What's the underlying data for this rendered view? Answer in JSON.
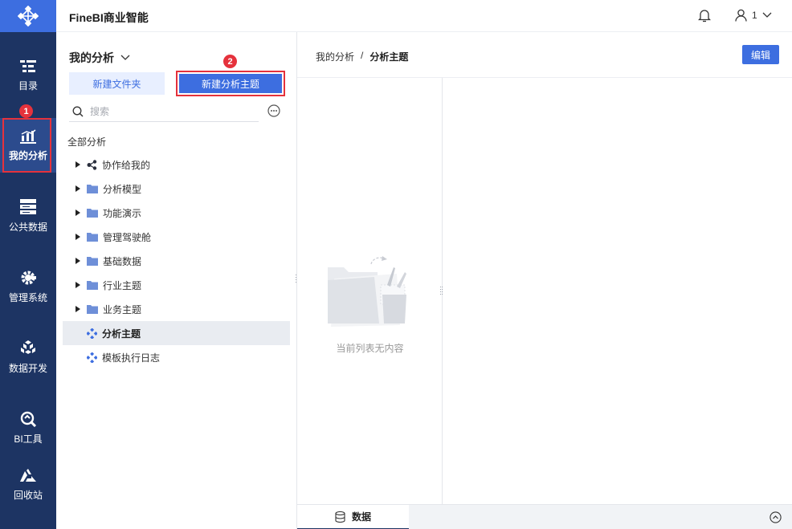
{
  "app": {
    "title": "FineBI商业智能"
  },
  "user": {
    "name": "1"
  },
  "nav": {
    "items": [
      {
        "label": "目录",
        "icon": "catalog-icon"
      },
      {
        "label": "我的分析",
        "icon": "analysis-chart-icon"
      },
      {
        "label": "公共数据",
        "icon": "database-icon"
      },
      {
        "label": "管理系统",
        "icon": "gear-icon"
      },
      {
        "label": "数据开发",
        "icon": "cube-icon"
      },
      {
        "label": "BI工具",
        "icon": "tool-icon"
      },
      {
        "label": "回收站",
        "icon": "recycle-icon"
      }
    ],
    "active_index": 1
  },
  "annotations": {
    "step1": "1",
    "step2": "2"
  },
  "panel": {
    "title": "我的分析",
    "new_folder_label": "新建文件夹",
    "new_subject_label": "新建分析主题",
    "search_placeholder": "搜索",
    "root_label": "全部分析",
    "tree": [
      {
        "label": "协作给我的",
        "type": "share"
      },
      {
        "label": "分析模型",
        "type": "folder"
      },
      {
        "label": "功能演示",
        "type": "folder"
      },
      {
        "label": "管理驾驶舱",
        "type": "folder"
      },
      {
        "label": "基础数据",
        "type": "folder"
      },
      {
        "label": "行业主题",
        "type": "folder"
      },
      {
        "label": "业务主题",
        "type": "folder"
      },
      {
        "label": "分析主题",
        "type": "subject",
        "selected": true
      },
      {
        "label": "模板执行日志",
        "type": "subject"
      }
    ]
  },
  "main": {
    "breadcrumb": [
      "我的分析",
      "分析主题"
    ],
    "breadcrumb_sep": "/",
    "edit_label": "编辑",
    "empty_text": "当前列表无内容",
    "bottom_tab": "数据"
  },
  "colors": {
    "nav_bg": "#1d3463",
    "accent": "#3d6ee0",
    "highlight": "#e5323c"
  }
}
